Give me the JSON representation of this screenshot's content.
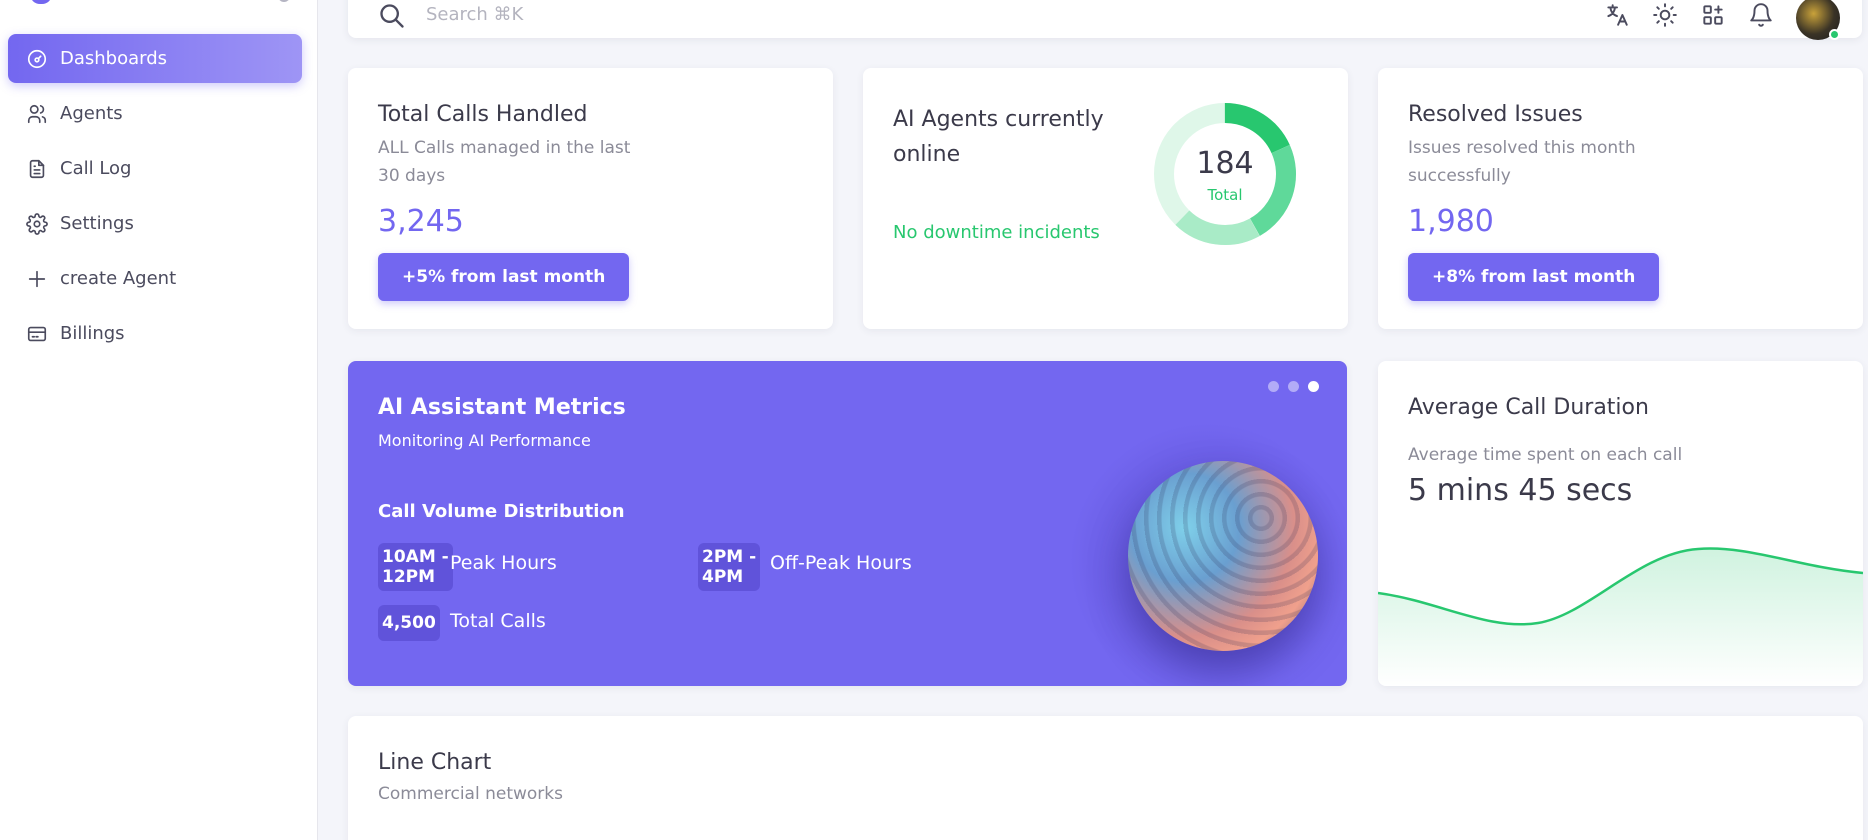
{
  "sidebar": {
    "items": [
      {
        "label": "Dashboards",
        "icon": "dashboard-icon",
        "active": true
      },
      {
        "label": "Agents",
        "icon": "users-icon",
        "active": false
      },
      {
        "label": "Call Log",
        "icon": "file-text-icon",
        "active": false
      },
      {
        "label": "Settings",
        "icon": "gear-icon",
        "active": false
      },
      {
        "label": "create Agent",
        "icon": "plus-icon",
        "active": false
      },
      {
        "label": "Billings",
        "icon": "credit-card-icon",
        "active": false
      }
    ]
  },
  "topbar": {
    "search_placeholder": "Search ⌘K",
    "icons": [
      "translate-icon",
      "sun-icon",
      "shortcuts-icon",
      "bell-icon"
    ],
    "status_color": "#28c76f"
  },
  "cards": {
    "total_calls": {
      "title": "Total Calls Handled",
      "subtitle_line1": "ALL Calls managed in the last",
      "subtitle_line2": "30 days",
      "value": "3,245",
      "button": "+5% from last month"
    },
    "agents_online": {
      "title_line1": "AI Agents currently",
      "title_line2": "online",
      "status": "No downtime incidents",
      "donut_value": "184",
      "donut_label": "Total"
    },
    "resolved": {
      "title": "Resolved Issues",
      "subtitle_line1": "Issues resolved this month",
      "subtitle_line2": "successfully",
      "value": "1,980",
      "button": "+8% from last month"
    }
  },
  "metrics": {
    "title": "AI Assistant Metrics",
    "subtitle": "Monitoring AI Performance",
    "section": "Call Volume Distribution",
    "peak_chip_line1": "10AM -",
    "peak_chip_line2": "12PM",
    "peak_label": "Peak Hours",
    "offpeak_chip_line1": "2PM -",
    "offpeak_chip_line2": "4PM",
    "offpeak_label": "Off-Peak Hours",
    "total_chip": "4,500",
    "total_label": "Total Calls",
    "carousel_active_index": 2,
    "accent": "#7367f0"
  },
  "duration": {
    "title": "Average Call Duration",
    "subtitle": "Average time spent on each call",
    "value": "5 mins 45 secs",
    "line_color": "#28c76f"
  },
  "line_chart": {
    "title": "Line Chart",
    "subtitle": "Commercial networks"
  }
}
